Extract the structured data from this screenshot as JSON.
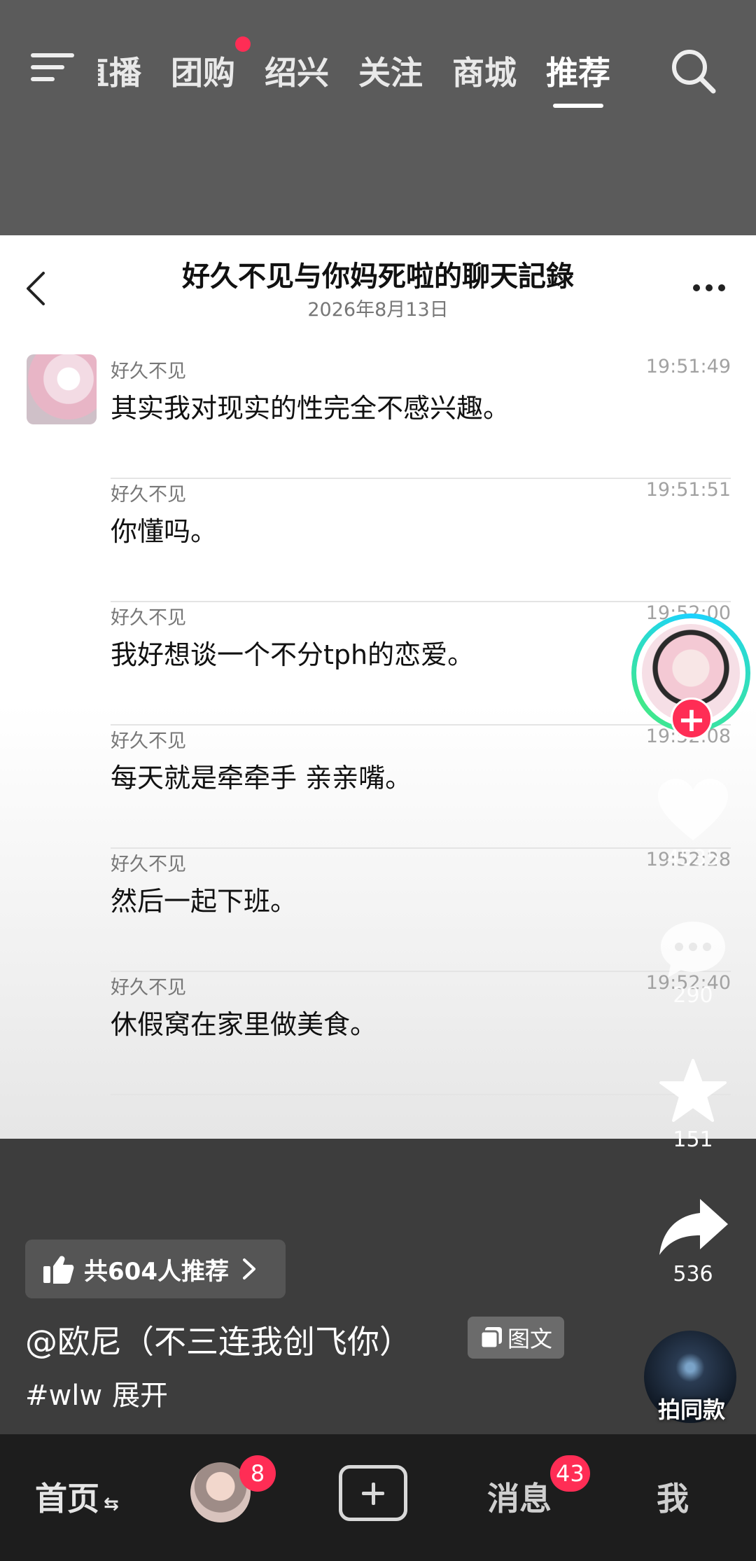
{
  "top_nav": {
    "tabs": [
      {
        "label": "直播"
      },
      {
        "label": "团购",
        "has_dot": true
      },
      {
        "label": "绍兴"
      },
      {
        "label": "关注"
      },
      {
        "label": "商城"
      },
      {
        "label": "推荐",
        "active": true
      }
    ],
    "icons": [
      "menu-icon",
      "search-icon"
    ]
  },
  "chat": {
    "title": "好久不见与你妈死啦的聊天記錄",
    "date": "2026年8月13日",
    "messages": [
      {
        "sender": "好久不见",
        "time": "19:51:49",
        "text": "其实我对现实的性完全不感兴趣。"
      },
      {
        "sender": "好久不见",
        "time": "19:51:51",
        "text": "你懂吗。"
      },
      {
        "sender": "好久不见",
        "time": "19:52:00",
        "text": "我好想谈一个不分tph的恋爱。"
      },
      {
        "sender": "好久不见",
        "time": "19:52:08",
        "text": "每天就是牵牵手 亲亲嘴。"
      },
      {
        "sender": "好久不见",
        "time": "19:52:28",
        "text": "然后一起下班。"
      },
      {
        "sender": "好久不见",
        "time": "19:52:40",
        "text": "休假窝在家里做美食。"
      }
    ]
  },
  "side_actions": {
    "likes": "4535",
    "comments": "290",
    "favorites": "151",
    "shares": "536"
  },
  "info": {
    "recommend": "共604人推荐",
    "author": "@欧尼（不三连我创飞你）",
    "type_badge": "图文",
    "hashtag": "#wlw",
    "expand": "展开",
    "same_style": "拍同款"
  },
  "bottom_nav": {
    "home": "首页",
    "friends_badge": "8",
    "messages": "消息",
    "messages_badge": "43",
    "me": "我"
  },
  "colors": {
    "accent": "#ff2d55",
    "topbar": "#5b5b5b",
    "navbar": "#1d1d1d"
  }
}
